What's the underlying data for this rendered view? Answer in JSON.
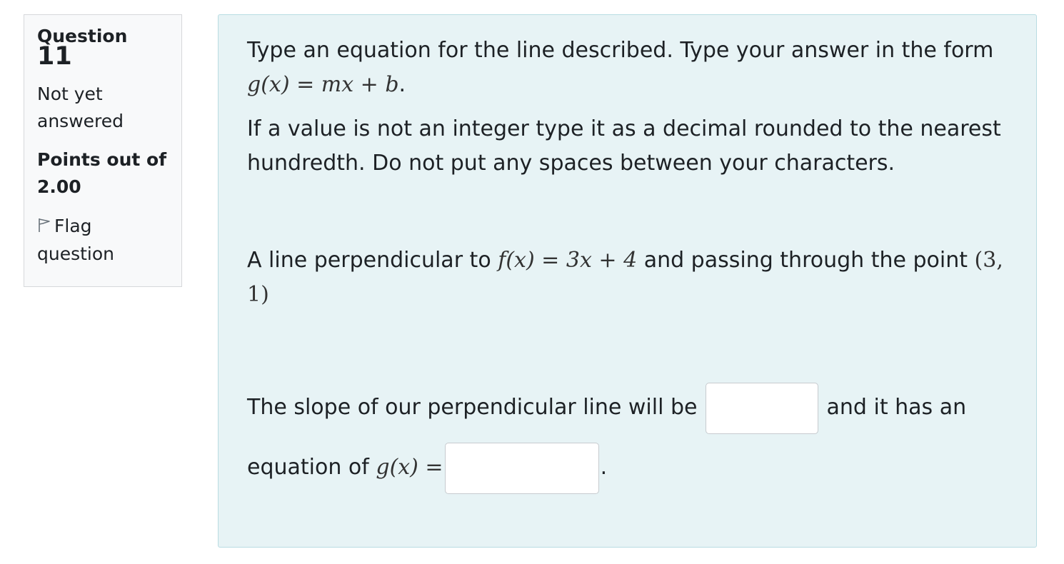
{
  "info": {
    "question_label": "Question",
    "question_number": "11",
    "state": "Not yet answered",
    "grade": "Points out of 2.00",
    "flag_label": "Flag question"
  },
  "question": {
    "p1_text": "Type an equation for the line described. Type your answer in the form ",
    "p1_math": "g(x) = mx + b",
    "p1_end": ".",
    "p2": "If a value is not an integer type it as a decimal rounded to the nearest hundredth. Do not put any spaces between your characters.",
    "p3_a": "A line perpendicular to ",
    "p3_math1": "f(x) = 3x + 4",
    "p3_b": " and passing through the point ",
    "p3_math2": "(3, 1)",
    "p4_a": "The slope of our perpendicular line will be ",
    "p4_b": " and it has an equation of ",
    "p4_math": "g(x) =",
    "p4_end": ".",
    "slope_value": "",
    "equation_value": ""
  },
  "colors": {
    "info_bg": "#f8f9fa",
    "question_bg": "#e7f3f5",
    "question_border": "#b8dce2"
  }
}
